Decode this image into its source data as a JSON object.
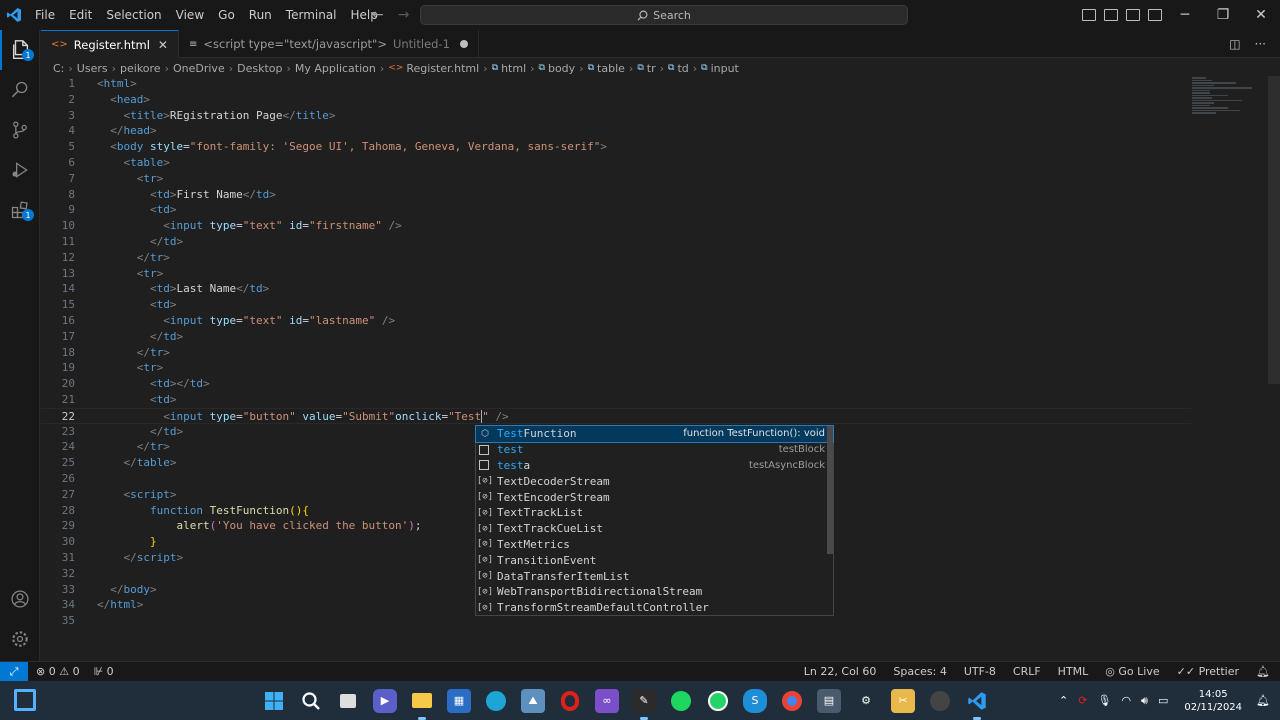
{
  "menu": [
    "File",
    "Edit",
    "Selection",
    "View",
    "Go",
    "Run",
    "Terminal",
    "Help"
  ],
  "search": {
    "label": "Search"
  },
  "tabs": [
    {
      "label": "Register.html",
      "active": true
    },
    {
      "label": "<script type=\"text/javascript\">",
      "sub": "Untitled-1",
      "modified": true
    }
  ],
  "breadcrumb": {
    "drive": "C:",
    "parts": [
      "Users",
      "peikore",
      "OneDrive",
      "Desktop",
      "My Application"
    ],
    "file": "Register.html",
    "symbols": [
      "html",
      "body",
      "table",
      "tr",
      "td",
      "input"
    ]
  },
  "editor": {
    "current_line": 22,
    "line_numbers": [
      "1",
      "2",
      "3",
      "4",
      "5",
      "6",
      "7",
      "8",
      "9",
      "10",
      "11",
      "12",
      "13",
      "14",
      "15",
      "16",
      "17",
      "18",
      "19",
      "20",
      "21",
      "22",
      "23",
      "24",
      "25",
      "26",
      "27",
      "28",
      "29",
      "30",
      "31",
      "32",
      "33",
      "34",
      "35"
    ],
    "title_text": "REgistration Page",
    "body_style": "\"font-family: 'Segoe UI', Tahoma, Geneva, Verdana, sans-serif\"",
    "first_name": "First Name",
    "last_name": "Last Name",
    "firstname_id": "\"firstname\"",
    "lastname_id": "\"lastname\"",
    "text_type": "\"text\"",
    "button_type": "\"button\"",
    "submit_value": "\"Submit\"",
    "onclick_partial": "\"Test",
    "function_name": "TestFunction",
    "alert_text": "'You have clicked the button'"
  },
  "suggestions": [
    {
      "prefix": "Test",
      "rest": "Function",
      "detail": "function TestFunction(): void",
      "icon": "cube-icon",
      "selected": true
    },
    {
      "prefix": "test",
      "rest": "",
      "detail": "testBlock",
      "icon": "snippet-icon"
    },
    {
      "prefix": "test",
      "rest": "a",
      "detail": "testAsyncBlock",
      "icon": "snippet-icon"
    },
    {
      "label": "TextDecoderStream",
      "icon": "variable-icon"
    },
    {
      "label": "TextEncoderStream",
      "icon": "variable-icon"
    },
    {
      "label": "TextTrackList",
      "icon": "variable-icon"
    },
    {
      "label": "TextTrackCueList",
      "icon": "variable-icon"
    },
    {
      "label": "TextMetrics",
      "icon": "variable-icon"
    },
    {
      "label": "TransitionEvent",
      "icon": "variable-icon"
    },
    {
      "label": "DataTransferItemList",
      "icon": "variable-icon"
    },
    {
      "label": "WebTransportBidirectionalStream",
      "icon": "variable-icon"
    },
    {
      "label": "TransformStreamDefaultController",
      "icon": "variable-icon"
    }
  ],
  "statusbar": {
    "errors": "0",
    "warnings": "0",
    "ports": "0",
    "position": "Ln 22, Col 60",
    "spaces": "Spaces: 4",
    "encoding": "UTF-8",
    "eol": "CRLF",
    "language": "HTML",
    "golive": "Go Live",
    "prettier": "Prettier"
  },
  "taskbar": {
    "time": "14:05",
    "date": "02/11/2024",
    "apps": [
      "windows-icon",
      "search-icon",
      "files-icon",
      "meet-icon",
      "explorer-icon",
      "store-icon",
      "edge-icon",
      "photos-icon",
      "opera-icon",
      "visual-studio-icon",
      "notes-icon",
      "spotify-icon",
      "whatsapp-icon",
      "skype-icon",
      "chrome-icon",
      "calculator-icon",
      "settings-icon",
      "paint-icon",
      "davinci-icon",
      "vscode-icon"
    ]
  },
  "colors": {
    "accent": "#0078d4",
    "tag": "#569cd6",
    "attr": "#9cdcfe",
    "string": "#ce9178",
    "function": "#dcdcaa"
  }
}
